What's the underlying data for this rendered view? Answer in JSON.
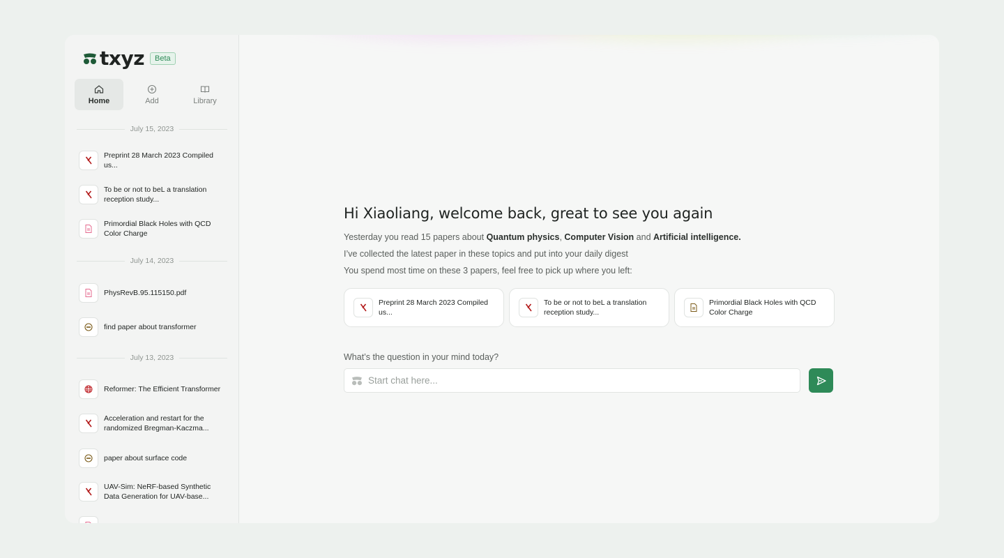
{
  "brand": {
    "name": "txyz",
    "badge": "Beta",
    "accent": "#2e8a58",
    "logo_color": "#1e5a37"
  },
  "nav": [
    {
      "label": "Home",
      "icon": "home-icon",
      "active": true
    },
    {
      "label": "Add",
      "icon": "plus-circle-icon",
      "active": false
    },
    {
      "label": "Library",
      "icon": "book-icon",
      "active": false
    }
  ],
  "history": [
    {
      "date": "July 15, 2023",
      "items": [
        {
          "title": "Preprint 28 March 2023 Compiled us...",
          "type": "arxiv"
        },
        {
          "title": "To be or not to beL a translation reception study...",
          "type": "arxiv"
        },
        {
          "title": "Primordial Black Holes with QCD Color Charge",
          "type": "pdf"
        }
      ]
    },
    {
      "date": "July 14, 2023",
      "items": [
        {
          "title": "PhysRevB.95.115150.pdf",
          "type": "pdf"
        },
        {
          "title": "find paper about transformer",
          "type": "chat"
        }
      ]
    },
    {
      "date": "July 13, 2023",
      "items": [
        {
          "title": "Reformer: The Efficient Transformer",
          "type": "web"
        },
        {
          "title": "Acceleration and restart for the randomized Bregman-Kaczma...",
          "type": "arxiv"
        },
        {
          "title": "paper about surface code",
          "type": "chat"
        },
        {
          "title": "UAV-Sim: NeRF-based Synthetic Data Generation for UAV-base...",
          "type": "arxiv"
        }
      ]
    }
  ],
  "main": {
    "greeting": "Hi Xiaoliang, welcome back, great to see you again",
    "line1_pre": "Yesterday you read 15 papers about ",
    "topic1": "Quantum physics",
    "sep1": ", ",
    "topic2": "Computer Vision",
    "sep2": " and ",
    "topic3": "Artificial intelligence.",
    "line2": "I’ve collected the latest paper in these topics and put into your daily digest",
    "line3": "You spend most time on these 3 papers, feel free to pick up where you left:",
    "recent_cards": [
      {
        "title": "Preprint 28 March 2023 Compiled us...",
        "type": "arxiv"
      },
      {
        "title": "To be or not to beL a translation reception study...",
        "type": "arxiv"
      },
      {
        "title": "Primordial Black Holes with QCD Color Charge",
        "type": "doc"
      }
    ],
    "question_label": "What’s the question in your mind today?",
    "chat_placeholder": "Start chat here...",
    "send_icon": "send-icon"
  }
}
